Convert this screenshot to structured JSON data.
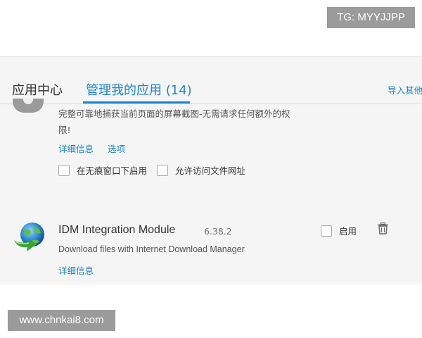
{
  "overlay": {
    "tg_badge": "TG: MYYJJPP",
    "watermark": "www.chnkai8.com"
  },
  "tabs": {
    "store": "应用中心",
    "manage": "管理我的应用 (14)",
    "import": "导入其他"
  },
  "extensions": [
    {
      "description": "完整可靠地捕获当前页面的屏幕截图-无需请求任何额外的权限!",
      "links": [
        "详细信息",
        "选项"
      ],
      "checkboxes": [
        {
          "label": "在无痕窗口下启用",
          "checked": false
        },
        {
          "label": "允许访问文件网址",
          "checked": false
        }
      ]
    },
    {
      "name": "IDM Integration Module",
      "version": "6.38.2",
      "enable_label": "启用",
      "enabled": false,
      "description": "Download files with Internet Download Manager",
      "details_link": "详细信息",
      "icon": "idm-globe-icon"
    }
  ],
  "colors": {
    "accent": "#1b84d1",
    "panel_bg": "#f5f5f5",
    "badge_bg": "#9b9b9b"
  }
}
